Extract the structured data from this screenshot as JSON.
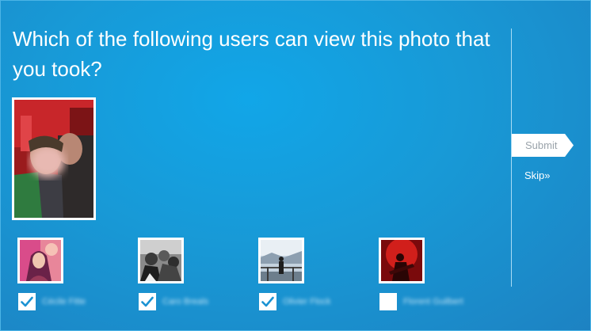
{
  "question": "Which of the following users can view this photo that you took?",
  "actions": {
    "submit_label": "Submit",
    "skip_label": "Skip»"
  },
  "users": [
    {
      "name": "Cécile Fitte",
      "checked": true
    },
    {
      "name": "Caro Breals",
      "checked": true
    },
    {
      "name": "Olivier Flock",
      "checked": true
    },
    {
      "name": "Florent Guilbert",
      "checked": false
    }
  ],
  "colors": {
    "background": "#1899d6",
    "checkmark": "#1b93d3"
  }
}
